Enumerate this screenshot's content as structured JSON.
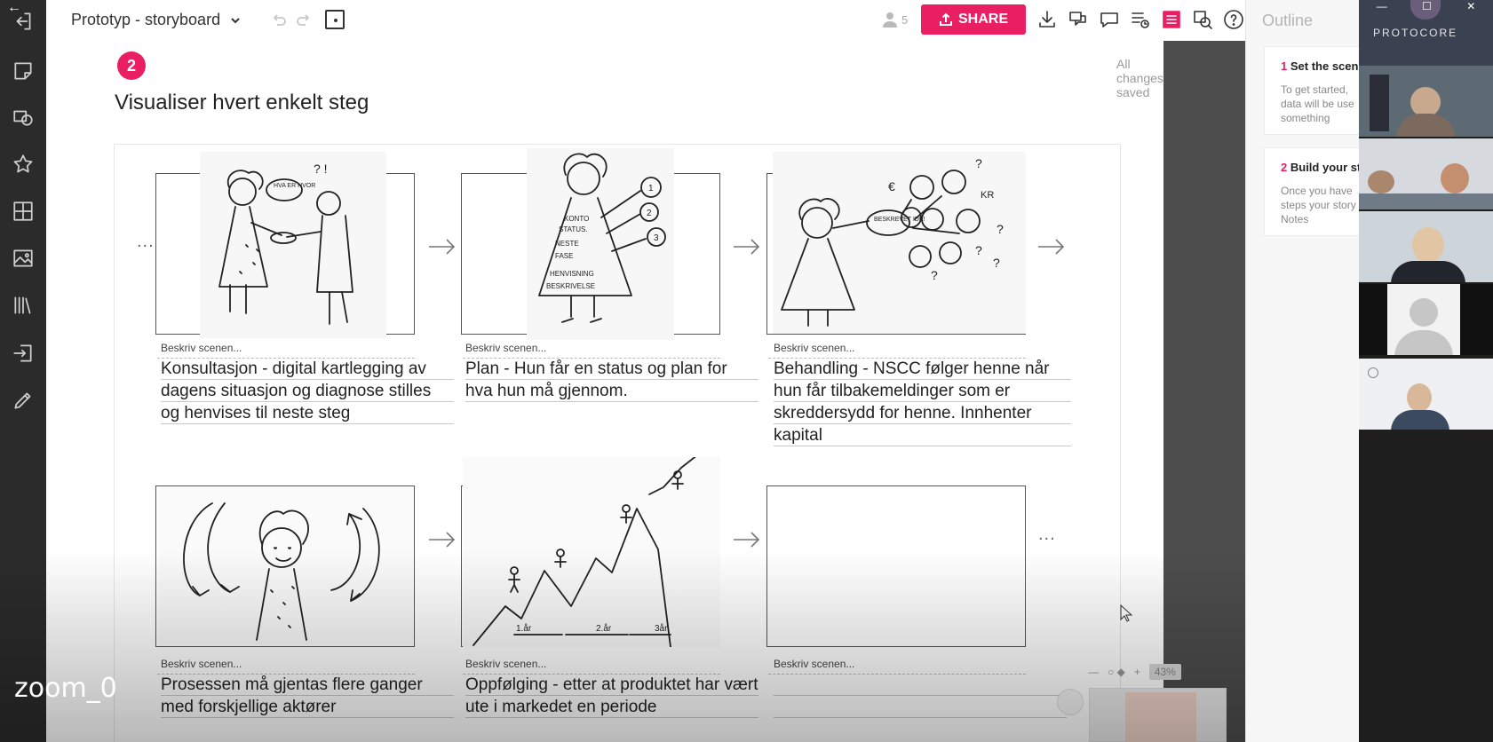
{
  "document": {
    "title": "Prototyp - storyboard"
  },
  "toolbar": {
    "user_count": "5",
    "share_label": "SHARE"
  },
  "canvas": {
    "saved_status": "All changes saved",
    "step_number": "2",
    "step_title": "Visualiser hvert enkelt steg"
  },
  "storyboard": {
    "more_symbol": "...",
    "cells": [
      {
        "hint": "Beskriv scenen...",
        "caption": "Konsultasjon - digital kartlegging av dagens situasjon og diagnose stilles og henvises til neste steg"
      },
      {
        "hint": "Beskriv scenen...",
        "caption": "Plan - Hun får en status og plan for hva hun må gjennom."
      },
      {
        "hint": "Beskriv scenen...",
        "caption": "Behandling - NSCC følger henne når hun får tilbakemeldinger som er skreddersydd for henne. Innhenter kapital"
      },
      {
        "hint": "Beskriv scenen...",
        "caption": "Prosessen må gjentas flere ganger med forskjellige aktører"
      },
      {
        "hint": "Beskriv scenen...",
        "caption": "Oppfølging - etter at produktet har vært ute i markedet en periode"
      },
      {
        "hint": "Beskriv scenen...",
        "caption": ""
      }
    ],
    "sketch_text": {
      "s1_bubble": "HVA ER HVOR",
      "s1_marks": "? !",
      "s2_dress": [
        "KONTO",
        "STATUS.",
        "NESTE",
        "FASE",
        "HENVISNING",
        "BESKRIVELSE"
      ],
      "s2_circles": [
        "1",
        "2",
        "3"
      ],
      "s3_bubble": "BESKREVET IDE!",
      "s3_marks": [
        "€",
        "KR",
        "?",
        "?",
        "?",
        "?",
        "?"
      ],
      "s5_labels": [
        "1.år",
        "2.år",
        "3år"
      ]
    }
  },
  "outline": {
    "title": "Outline",
    "items": [
      {
        "number": "1",
        "heading": "Set the scene",
        "body": [
          "To get started,",
          "data will be use",
          "something"
        ]
      },
      {
        "number": "2",
        "heading": "Build your st",
        "body": [
          "Once you have",
          "steps your story",
          "Notes"
        ]
      }
    ]
  },
  "video": {
    "logo_text": "PROTOCORE",
    "zoom_label": "zoom_0",
    "zoom_percent": "43%"
  },
  "colors": {
    "accent": "#ea1e63",
    "rail": "#2b2b2b"
  }
}
